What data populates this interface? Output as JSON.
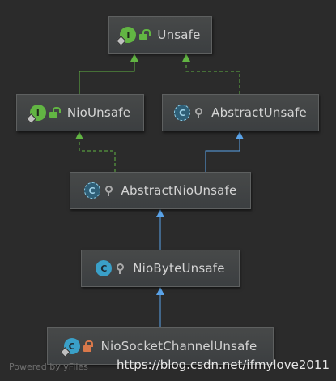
{
  "nodes": {
    "unsafe": {
      "label": "Unsafe",
      "kind": "interface",
      "letter": "I",
      "access": "public"
    },
    "nio_unsafe": {
      "label": "NioUnsafe",
      "kind": "interface",
      "letter": "I",
      "access": "public"
    },
    "abstract_unsafe": {
      "label": "AbstractUnsafe",
      "kind": "abstract-class",
      "letter": "C",
      "access": "protected"
    },
    "abstract_nio_unsafe": {
      "label": "AbstractNioUnsafe",
      "kind": "abstract-class",
      "letter": "C",
      "access": "protected"
    },
    "nio_byte_unsafe": {
      "label": "NioByteUnsafe",
      "kind": "class",
      "letter": "C",
      "access": "protected"
    },
    "nio_socket_channel_unsafe": {
      "label": "NioSocketChannelUnsafe",
      "kind": "class",
      "letter": "C",
      "access": "private"
    }
  },
  "edges": [
    {
      "from": "nio_unsafe",
      "to": "unsafe",
      "type": "extends",
      "style": "solid",
      "color": "#62b543"
    },
    {
      "from": "abstract_unsafe",
      "to": "unsafe",
      "type": "implements",
      "style": "dashed",
      "color": "#62b543"
    },
    {
      "from": "abstract_nio_unsafe",
      "to": "nio_unsafe",
      "type": "implements",
      "style": "dashed",
      "color": "#62b543"
    },
    {
      "from": "abstract_nio_unsafe",
      "to": "abstract_unsafe",
      "type": "extends",
      "style": "solid",
      "color": "#5aa3e8"
    },
    {
      "from": "nio_byte_unsafe",
      "to": "abstract_nio_unsafe",
      "type": "extends",
      "style": "solid",
      "color": "#5aa3e8"
    },
    {
      "from": "nio_socket_channel_unsafe",
      "to": "nio_byte_unsafe",
      "type": "extends",
      "style": "solid",
      "color": "#5aa3e8"
    }
  ],
  "colors": {
    "background": "#2b2b2b",
    "interface": "#62b543",
    "class": "#3aa0c8",
    "inheritance_arrow": "#5aa3e8",
    "implements_arrow": "#62b543"
  },
  "footer": {
    "powered_by": "Powered by yFiles",
    "watermark": "https://blog.csdn.net/ifmylove2011"
  }
}
